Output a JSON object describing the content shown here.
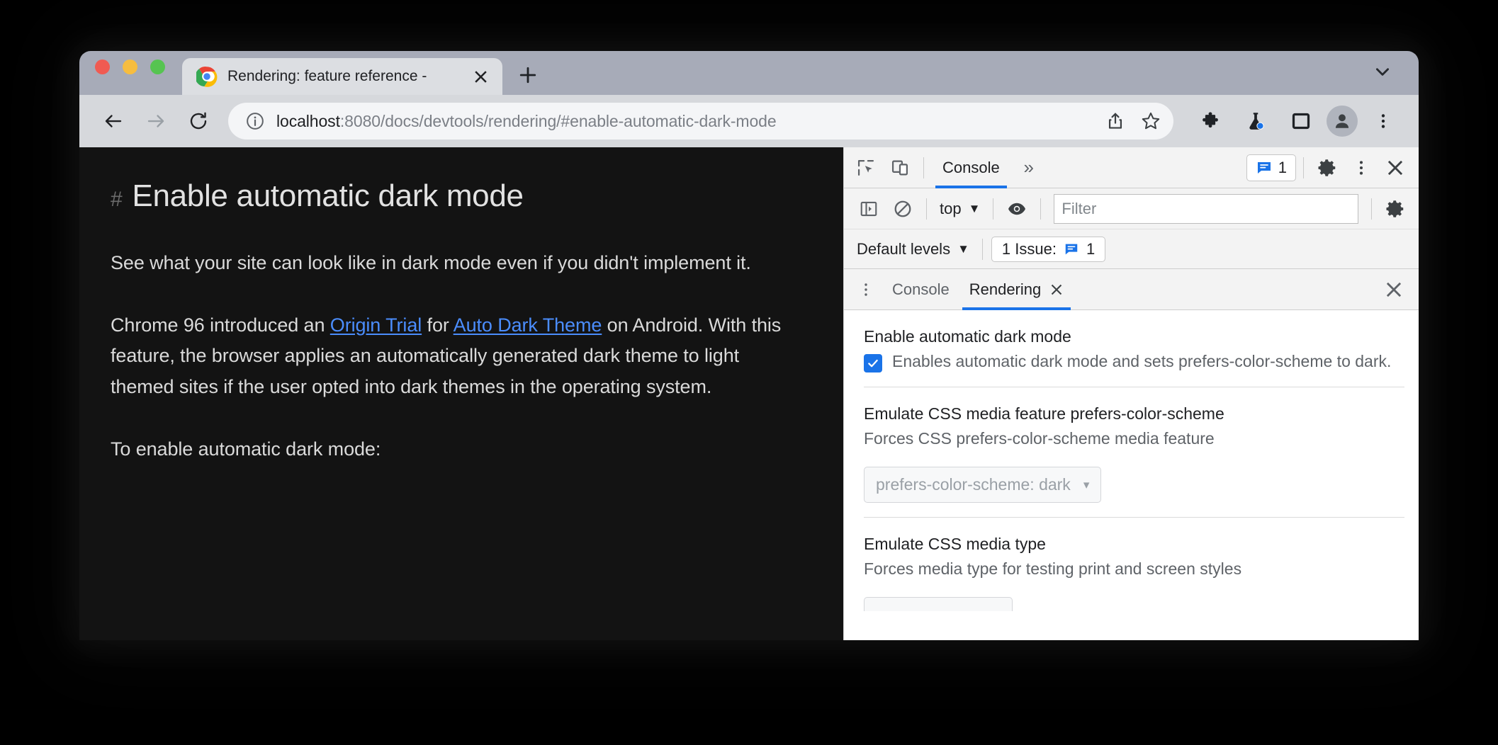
{
  "window": {
    "traffic_lights": [
      "close",
      "minimize",
      "maximize"
    ],
    "tab": {
      "title": "Rendering: feature reference -",
      "favicon": "chrome-logo-icon",
      "close_label": "✕"
    },
    "new_tab_label": "+",
    "tabstrip_chevron": "chevron-down-icon"
  },
  "toolbar": {
    "back_label": "←",
    "forward_label": "→",
    "reload_label": "↻",
    "site_info_icon": "info-circle-icon",
    "url_host": "localhost",
    "url_rest": ":8080/docs/devtools/rendering/#enable-automatic-dark-mode",
    "url_full": "localhost:8080/docs/devtools/rendering/#enable-automatic-dark-mode",
    "share_icon": "share-icon",
    "bookmark_icon": "star-icon",
    "extensions_icon": "puzzle-icon",
    "experiments_icon": "flask-icon",
    "side_panel_icon": "side-panel-icon",
    "profile_icon": "avatar-icon",
    "menu_icon": "kebab-menu-icon"
  },
  "page": {
    "heading_anchor": "#",
    "heading": "Enable automatic dark mode",
    "paragraph1": "See what your site can look like in dark mode even if you didn't implement it.",
    "paragraph2": {
      "pre": "Chrome 96 introduced an ",
      "link1": "Origin Trial",
      "mid": " for ",
      "link2": "Auto Dark Theme",
      "post": " on Android. With this feature, the browser applies an automatically generated dark theme to light themed sites if the user opted into dark themes in the operating system."
    },
    "paragraph3": "To enable automatic dark mode:"
  },
  "devtools": {
    "header": {
      "inspect_icon": "inspect-element-icon",
      "device_toggle_icon": "device-toolbar-icon",
      "tabs": [
        {
          "label": "Console",
          "active": true
        }
      ],
      "overflow_label": "»",
      "message_count": "1",
      "message_icon": "message-badge-icon",
      "settings_icon": "gear-icon",
      "more_icon": "kebab-menu-icon",
      "close_icon": "close-icon"
    },
    "console_toolbar": {
      "sidebar_toggle_icon": "console-sidebar-icon",
      "clear_icon": "clear-console-icon",
      "context_value": "top",
      "context_caret": "▼",
      "eye_icon": "live-expression-icon",
      "filter_placeholder": "Filter",
      "filter_value": "",
      "settings_icon": "gear-icon"
    },
    "levels_bar": {
      "levels_value": "Default levels",
      "levels_caret": "▼",
      "issue_label": "1 Issue:",
      "issue_icon": "message-badge-icon",
      "issue_count": "1"
    },
    "drawer": {
      "menu_icon": "kebab-menu-icon",
      "tabs": [
        {
          "label": "Console",
          "active": false,
          "closable": false
        },
        {
          "label": "Rendering",
          "active": true,
          "closable": true,
          "close_label": "✕"
        }
      ],
      "close_icon": "close-icon"
    },
    "rendering": {
      "sections": [
        {
          "title": "Enable automatic dark mode",
          "description": "Enables automatic dark mode and sets prefers-color-scheme to dark.",
          "has_checkbox": true,
          "checked": true
        },
        {
          "title": "Emulate CSS media feature prefers-color-scheme",
          "description": "Forces CSS prefers-color-scheme media feature",
          "has_checkbox": false,
          "select_value": "prefers-color-scheme: dark",
          "select_caret": "▾",
          "select_disabled": true
        },
        {
          "title": "Emulate CSS media type",
          "description": "Forces media type for testing print and screen styles",
          "has_checkbox": false,
          "select_value": "",
          "select_clipped": true
        }
      ]
    }
  },
  "colors": {
    "accent_blue": "#1a73e8",
    "link_blue": "#4b8dfd",
    "tabstrip_bg": "#a7abb8",
    "toolbar_bg": "#d6d8dc",
    "page_bg": "#131313",
    "devtools_bg": "#f3f3f3"
  }
}
